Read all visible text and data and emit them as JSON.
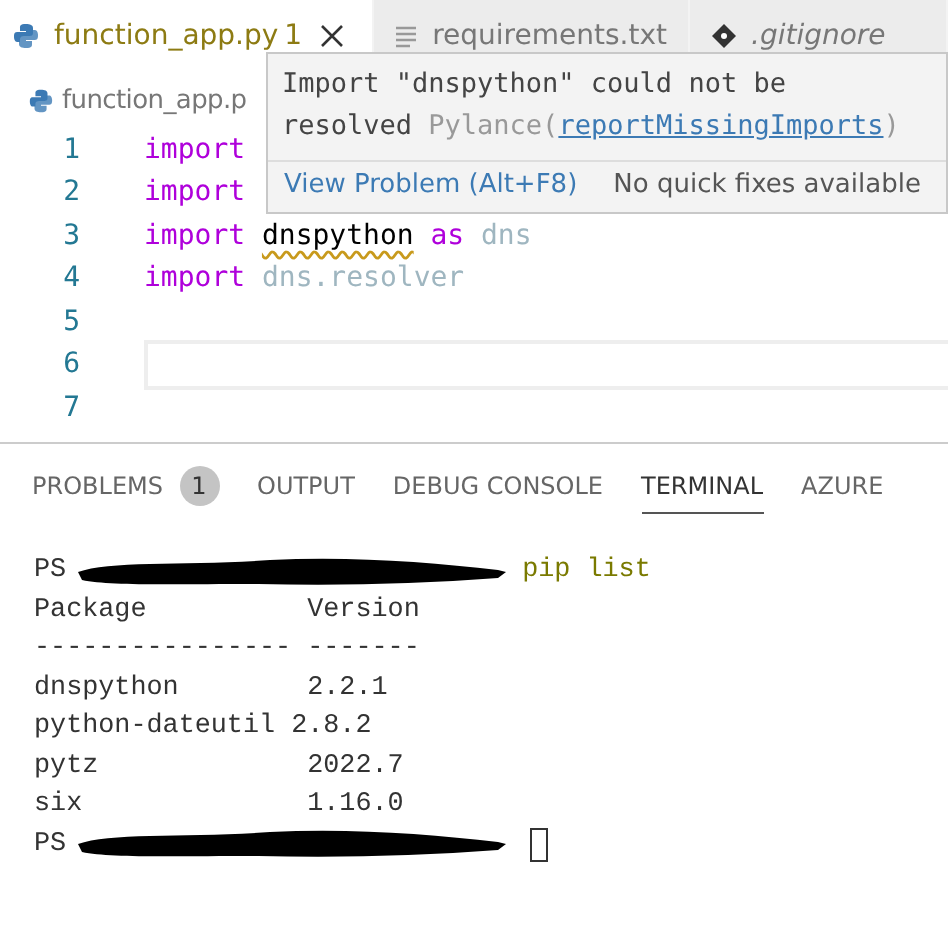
{
  "tabs": [
    {
      "kind": "python",
      "label": "function_app.py",
      "badge": "1",
      "selected": true
    },
    {
      "kind": "text",
      "label": "requirements.txt",
      "selected": false
    },
    {
      "kind": "git",
      "label": ".gitignore",
      "selected": false
    }
  ],
  "breadcrumb": "function_app.p",
  "code_lines": [
    {
      "number": "1",
      "current": false,
      "tokens": [
        {
          "kind": "keyword",
          "text": "import"
        }
      ]
    },
    {
      "number": "2",
      "current": false,
      "tokens": [
        {
          "kind": "keyword",
          "text": "import"
        }
      ]
    },
    {
      "number": "3",
      "current": false,
      "tokens": [
        {
          "kind": "keyword",
          "text": "import"
        },
        {
          "kind": "error",
          "text": "dnspython"
        },
        {
          "kind": "keyword",
          "text": "as"
        },
        {
          "kind": "module",
          "text": "dns"
        }
      ]
    },
    {
      "number": "4",
      "current": false,
      "tokens": [
        {
          "kind": "keyword",
          "text": "import"
        },
        {
          "kind": "module",
          "text": "dns.resolver"
        }
      ]
    },
    {
      "number": "5",
      "current": false
    },
    {
      "number": "6",
      "current": true
    },
    {
      "number": "7",
      "current": false
    }
  ],
  "hover": {
    "message": "Import \"dnspython\" could not be resolved",
    "source": "Pylance(",
    "link": "reportMissingImports",
    "close": ")",
    "action": "View Problem (Alt+F8)",
    "note": "No quick fixes available"
  },
  "panel_tabs": [
    {
      "label": "PROBLEMS",
      "badge": "1",
      "selected": false
    },
    {
      "label": "OUTPUT",
      "selected": false
    },
    {
      "label": "DEBUG CONSOLE",
      "selected": false
    },
    {
      "label": "TERMINAL",
      "selected": true
    },
    {
      "label": "AZURE",
      "selected": false
    }
  ],
  "terminal": [
    {
      "kind": "prompt",
      "prefix": "PS",
      "command": "pip list",
      "cursor": false
    },
    {
      "kind": "output",
      "text": "Package          Version"
    },
    {
      "kind": "output",
      "text": "---------------- -------"
    },
    {
      "kind": "output",
      "text": "dnspython        2.2.1"
    },
    {
      "kind": "output",
      "text": "python-dateutil 2.8.2"
    },
    {
      "kind": "output",
      "text": "pytz             2022.7"
    },
    {
      "kind": "output",
      "text": "six              1.16.0"
    },
    {
      "kind": "prompt",
      "prefix": "PS",
      "cursor": true
    }
  ]
}
